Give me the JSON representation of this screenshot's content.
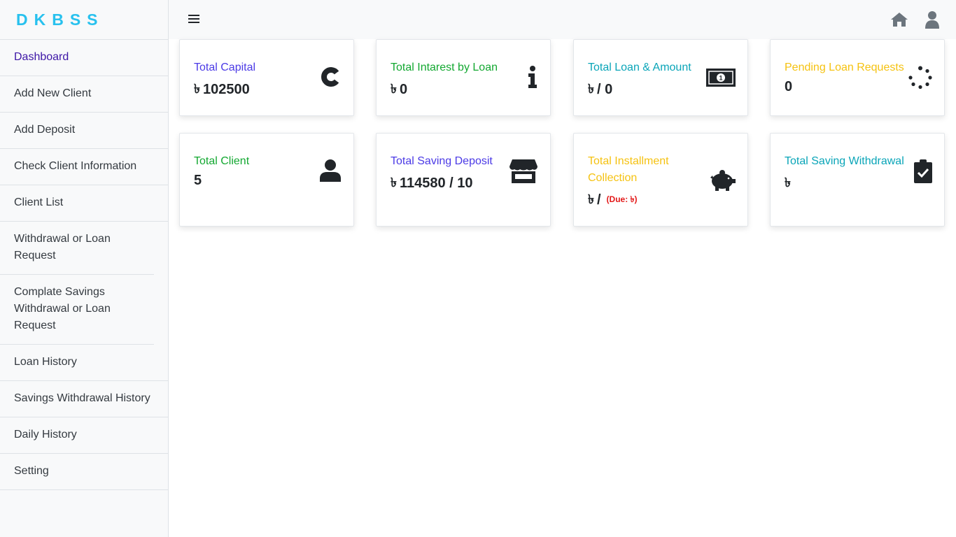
{
  "brand": "DKBSS",
  "sidebar": {
    "items": [
      {
        "label": "Dashboard"
      },
      {
        "label": "Add New Client"
      },
      {
        "label": "Add Deposit"
      },
      {
        "label": "Check Client Information"
      },
      {
        "label": "Client List"
      },
      {
        "label": "Withdrawal or Loan Request"
      },
      {
        "label": "Complate Savings Withdrawal or Loan Request"
      },
      {
        "label": "Loan History"
      },
      {
        "label": "Savings Withdrawal History"
      },
      {
        "label": "Daily History"
      },
      {
        "label": "Setting"
      }
    ]
  },
  "cards": {
    "total_capital": {
      "title": "Total Capital",
      "currency": "৳",
      "value": "102500"
    },
    "total_interest": {
      "title": "Total Intarest by Loan",
      "currency": "৳",
      "value": "0"
    },
    "total_loan": {
      "title": "Total Loan & Amount",
      "currency": "৳",
      "value": "/ 0"
    },
    "pending_loan": {
      "title": "Pending Loan Requests",
      "value": "0"
    },
    "total_client": {
      "title": "Total Client",
      "value": "5"
    },
    "total_saving_deposit": {
      "title": "Total Saving Deposit",
      "currency": "৳",
      "value": "114580 / 10"
    },
    "total_installment": {
      "title": "Total Installment Collection",
      "currency": "৳",
      "value": "/",
      "due": "(Due: ৳)"
    },
    "total_saving_withdrawal": {
      "title": "Total Saving Withdrawal",
      "currency": "৳"
    }
  },
  "colors": {
    "brand": "#28c1ee",
    "purple": "#4b3ae6",
    "green": "#13a831",
    "teal": "#0aa5b8",
    "yellow": "#f5c211",
    "due_red": "#e31919"
  },
  "icons": {
    "menu": "hamburger-icon",
    "home": "home-icon",
    "user": "user-icon",
    "capital": "copyright-c-icon",
    "interest": "info-icon",
    "loan": "money-bill-icon",
    "pending": "spinner-icon",
    "client": "user-icon",
    "saving_deposit": "store-icon",
    "installment": "piggy-bank-icon",
    "saving_withdrawal": "clipboard-check-icon"
  }
}
